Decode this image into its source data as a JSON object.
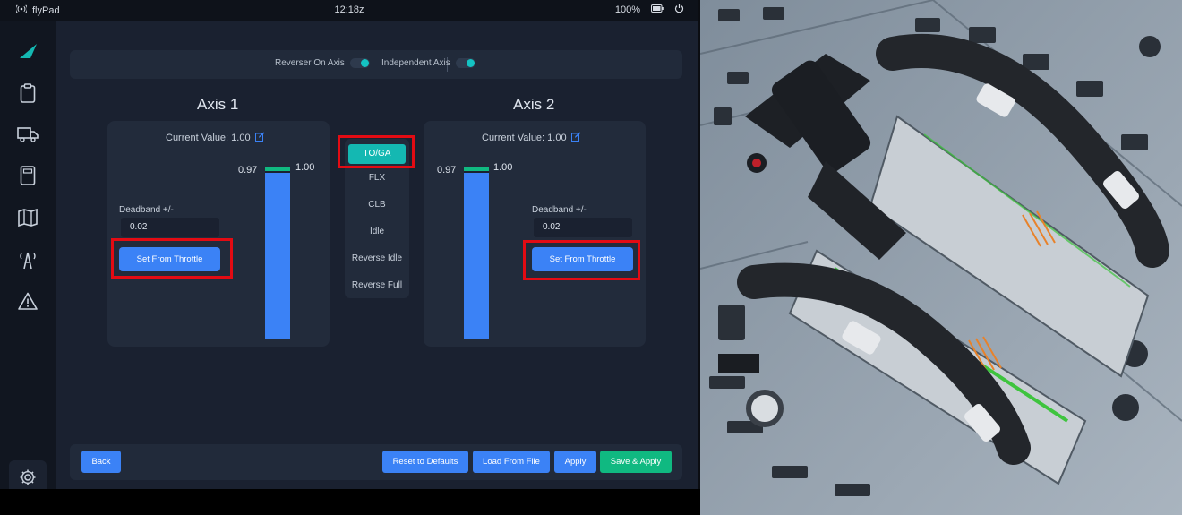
{
  "status_bar": {
    "app_name": "flyPad",
    "time": "12:18z",
    "battery": "100%"
  },
  "sidebar": {
    "items": [
      "logo-icon",
      "clipboard-icon",
      "truck-icon",
      "calculator-icon",
      "map-icon",
      "atc-tower-icon",
      "warning-icon"
    ],
    "settings": "gear-icon"
  },
  "toggles": {
    "reverser_label": "Reverser On Axis",
    "independent_label": "Independent Axis"
  },
  "axis1": {
    "title": "Axis 1",
    "current_value_label": "Current Value: 1.00",
    "deadband_label": "Deadband +/-",
    "deadband_value": "0.02",
    "set_button": "Set From Throttle",
    "bar_left_label": "0.97",
    "bar_right_label": "1.00",
    "fill": 0.97
  },
  "axis2": {
    "title": "Axis 2",
    "current_value_label": "Current Value: 1.00",
    "deadband_label": "Deadband +/-",
    "deadband_value": "0.02",
    "set_button": "Set From Throttle",
    "bar_left_label": "0.97",
    "bar_right_label": "1.00",
    "fill": 0.97
  },
  "modes": {
    "items": [
      "TO/GA",
      "FLX",
      "CLB",
      "Idle",
      "Reverse Idle",
      "Reverse Full"
    ],
    "selected": "TO/GA"
  },
  "footer": {
    "back": "Back",
    "reset": "Reset to Defaults",
    "load": "Load From File",
    "apply": "Apply",
    "save_apply": "Save & Apply"
  },
  "colors": {
    "accent_teal": "#14b8b2",
    "button_blue": "#3b82f6",
    "save_green": "#10b981",
    "highlight_red": "#e30b13"
  }
}
